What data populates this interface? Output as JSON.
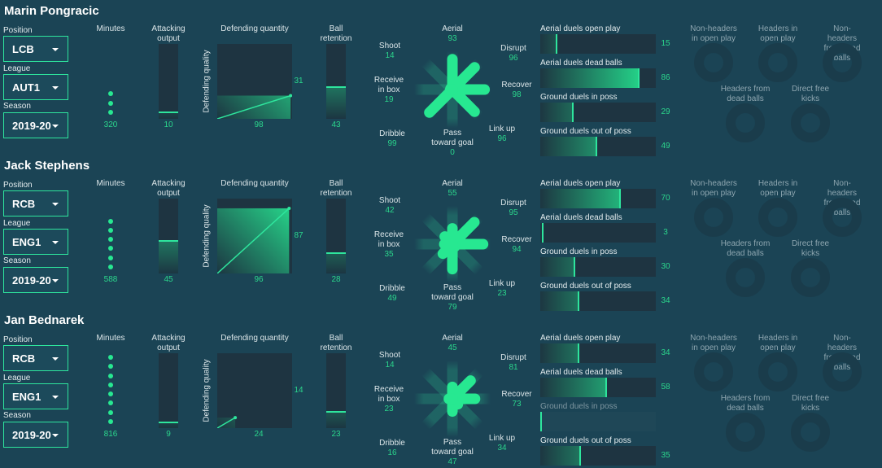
{
  "colors": {
    "background": "#1b4455",
    "panel": "#1e3441",
    "accent": "#2ee59d",
    "value_text": "#2bd68c",
    "ring": "#1a3c4b"
  },
  "labels": {
    "position": "Position",
    "league": "League",
    "season": "Season",
    "minutes": "Minutes",
    "attacking_output": "Attacking\noutput",
    "defending_quantity": "Defending quantity",
    "defending_quality": "Defending quality",
    "ball_retention": "Ball\nretention",
    "actions": [
      "Aerial",
      "Disrupt",
      "Recover",
      "Link up",
      "Pass\ntoward goal",
      "Dribble",
      "Receive\nin box",
      "Shoot"
    ],
    "duels": [
      "Aerial duels open play",
      "Aerial duels dead balls",
      "Ground duels in poss",
      "Ground duels out of poss"
    ],
    "set_pieces": [
      "Non-headers\nin open play",
      "Headers in\nopen play",
      "Non-headers\nfrom dead balls",
      "Headers from\ndead balls",
      "Direct free\nkicks"
    ]
  },
  "players": [
    {
      "name": "Marin Pongracic",
      "position": "LCB",
      "league": "AUT1",
      "season": "2019-20",
      "minutes": 320,
      "attacking_output": 10,
      "defending_quantity": 98,
      "defending_quality": 31,
      "ball_retention": 43,
      "actions": [
        93,
        96,
        98,
        96,
        0,
        99,
        19,
        14
      ],
      "duels": [
        15,
        86,
        29,
        49
      ]
    },
    {
      "name": "Jack Stephens",
      "position": "RCB",
      "league": "ENG1",
      "season": "2019-20",
      "minutes": 588,
      "attacking_output": 45,
      "defending_quantity": 96,
      "defending_quality": 87,
      "ball_retention": 28,
      "actions": [
        55,
        95,
        94,
        23,
        79,
        49,
        35,
        42
      ],
      "duels": [
        70,
        3,
        30,
        34
      ]
    },
    {
      "name": "Jan Bednarek",
      "position": "RCB",
      "league": "ENG1",
      "season": "2019-20",
      "minutes": 816,
      "attacking_output": 9,
      "defending_quantity": 24,
      "defending_quality": 14,
      "ball_retention": 23,
      "actions": [
        45,
        81,
        73,
        34,
        47,
        16,
        23,
        14
      ],
      "duels": [
        34,
        58,
        null,
        35
      ]
    }
  ]
}
